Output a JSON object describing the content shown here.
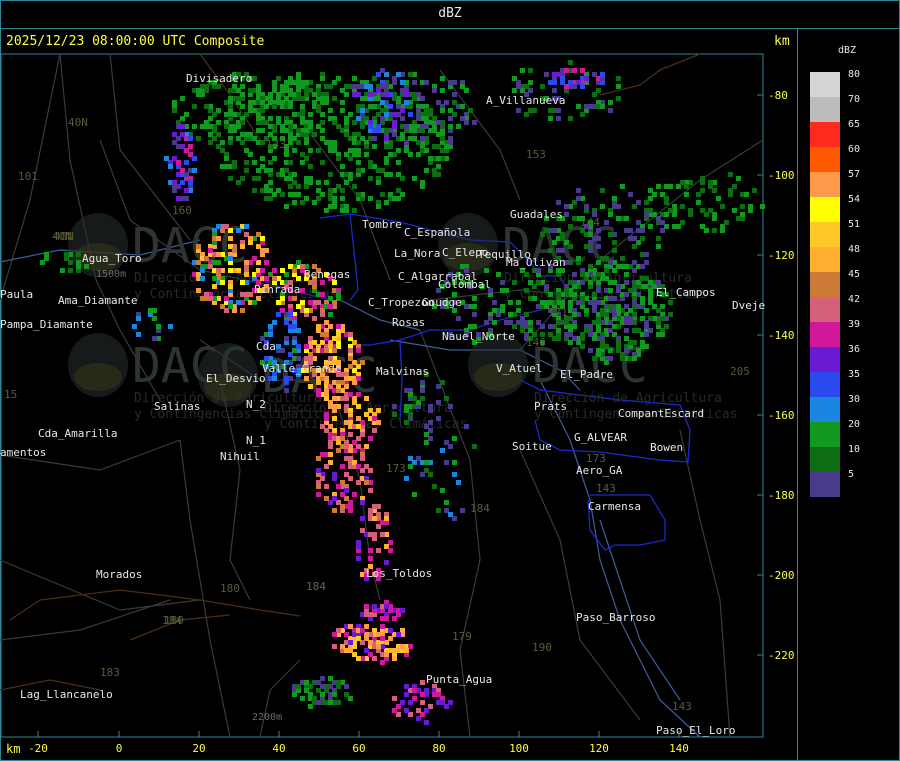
{
  "window": {
    "title": "dBZ"
  },
  "map": {
    "header": "2025/12/23 08:00:00 UTC Composite",
    "unit_top": "km",
    "unit_bottom": "km",
    "x_ticks": [
      "-20",
      "0",
      "20",
      "40",
      "60",
      "80",
      "100",
      "120",
      "140"
    ],
    "y_ticks": [
      "-80",
      "-100",
      "-120",
      "-140",
      "-160",
      "-180",
      "-200",
      "-220"
    ],
    "places": [
      "Divisadero",
      "A_Villanueva",
      "Guadales",
      "Tombre",
      "C_Española",
      "C_Elepo",
      "Tequillo",
      "Ma_Olivan",
      "Agua_Toro",
      "La_Nora",
      "Benegas",
      "C_Algarrabal",
      "Colombal",
      "El_Campos",
      "Dveje",
      "Paula",
      "Pampa_Diamante",
      "C_Tropezon",
      "Goudge",
      "Rosas",
      "Ama_Diamante",
      "Cda_Amarilla",
      "Pinrada",
      "Cda",
      "Malvinas",
      "Nauel_Norte",
      "V_Atuel",
      "El_Desvio",
      "Valle_Grande",
      "Salinas",
      "N_2",
      "N_1",
      "Nihuil",
      "Soitue",
      "G_ALVEAR",
      "CompantEscard",
      "Bowen",
      "Aero_GA",
      "Carmensa",
      "Los_Toldos",
      "Morados",
      "Paso_Barroso",
      "Punta_Agua",
      "Lag_Llancanelo",
      "Paso_El_Loro",
      "El_Padre",
      "Prats",
      "amentos"
    ],
    "route_numbers": [
      "40N",
      "40N",
      "101",
      "143",
      "153",
      "144",
      "171",
      "146",
      "160",
      "173",
      "184",
      "184",
      "180",
      "184",
      "183",
      "179",
      "180",
      "184",
      "173",
      "190",
      "143",
      "143",
      "205",
      "40N",
      "15"
    ],
    "elevation_labels": [
      "1500m",
      "2200m"
    ],
    "watermark": [
      "DACC",
      "Dirección de Agricultura",
      "y Contingencias Climáticas"
    ]
  },
  "legend": {
    "title": "dBZ",
    "entries": [
      {
        "label": "80",
        "color": "#d4d4d4"
      },
      {
        "label": "70",
        "color": "#bcbcbc"
      },
      {
        "label": "65",
        "color": "#ff2a1e"
      },
      {
        "label": "60",
        "color": "#ff5a00"
      },
      {
        "label": "57",
        "color": "#ff9a4a"
      },
      {
        "label": "54",
        "color": "#ffff00"
      },
      {
        "label": "51",
        "color": "#ffc828"
      },
      {
        "label": "48",
        "color": "#ffb030"
      },
      {
        "label": "45",
        "color": "#cc7a36"
      },
      {
        "label": "42",
        "color": "#d4607a"
      },
      {
        "label": "39",
        "color": "#d2189a"
      },
      {
        "label": "36",
        "color": "#6a1ad2"
      },
      {
        "label": "35",
        "color": "#2a4af0"
      },
      {
        "label": "30",
        "color": "#1a86e2"
      },
      {
        "label": "20",
        "color": "#129a20"
      },
      {
        "label": "10",
        "color": "#0e6c12"
      },
      {
        "label": "5",
        "color": "#4a3a8c"
      }
    ]
  }
}
